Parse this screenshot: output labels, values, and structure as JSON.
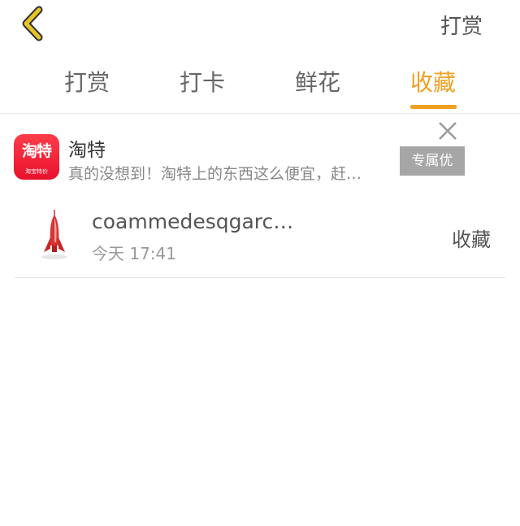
{
  "header": {
    "back_icon": "chevron-left-icon",
    "back_color": "#e8c425",
    "title_right": "打赏"
  },
  "tabs": [
    {
      "label": "打赏",
      "active": false
    },
    {
      "label": "打卡",
      "active": false
    },
    {
      "label": "鲜花",
      "active": false
    },
    {
      "label": "收藏",
      "active": true
    }
  ],
  "accent_color": "#f0a020",
  "ad": {
    "logo_text": "淘特",
    "logo_subtext": "淘宝特价",
    "title": "淘特",
    "description": "真的没想到！淘特上的东西这么便宜，赶…",
    "button_label": "专属优",
    "close_icon": "close-icon"
  },
  "list": [
    {
      "icon": "rocket-icon",
      "title": "coammedesqgarc…",
      "time": "今天 17:41",
      "action": "收藏"
    }
  ]
}
